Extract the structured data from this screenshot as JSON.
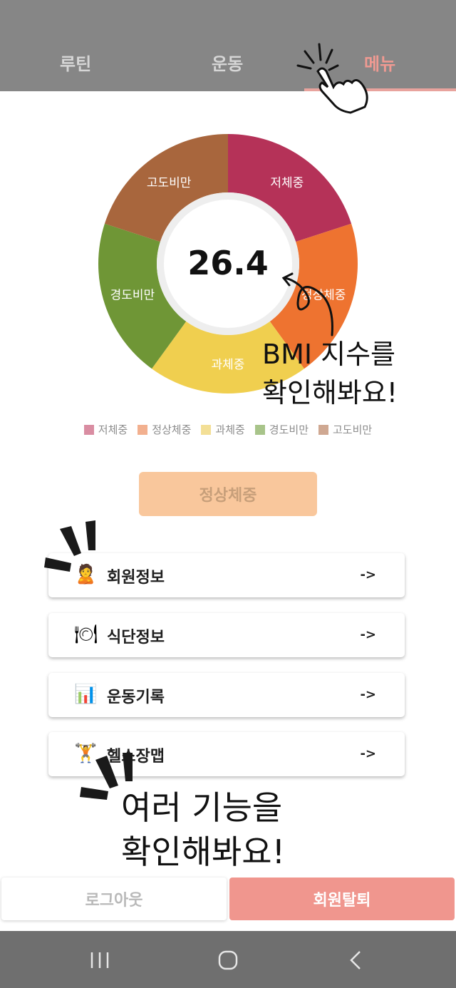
{
  "tabs": [
    {
      "label": "루틴",
      "active": false
    },
    {
      "label": "운동",
      "active": false
    },
    {
      "label": "메뉴",
      "active": true
    }
  ],
  "bmi": {
    "value": "26.4",
    "categories": [
      {
        "label": "저체중",
        "color": "#b53258"
      },
      {
        "label": "정상체중",
        "color": "#ee7330"
      },
      {
        "label": "과체중",
        "color": "#f0cf4f"
      },
      {
        "label": "경도비만",
        "color": "#6f9636"
      },
      {
        "label": "고도비만",
        "color": "#a8663d"
      }
    ],
    "status_label": "정상체중"
  },
  "legend": [
    {
      "label": "저체중",
      "color": "#d98da2"
    },
    {
      "label": "정상체중",
      "color": "#f2b08f"
    },
    {
      "label": "과체중",
      "color": "#f3df96"
    },
    {
      "label": "경도비만",
      "color": "#a8c48a"
    },
    {
      "label": "고도비만",
      "color": "#cfa892"
    }
  ],
  "menu": [
    {
      "icon": "person-icon",
      "glyph": "🙎",
      "label": "회원정보",
      "arrow": "->"
    },
    {
      "icon": "plate-icon",
      "glyph": "🍽",
      "label": "식단정보",
      "arrow": "->"
    },
    {
      "icon": "bar-chart-icon",
      "glyph": "📊",
      "label": "운동기록",
      "arrow": "->"
    },
    {
      "icon": "weightlifter-icon",
      "glyph": "🏋",
      "label": "헬스장맵",
      "arrow": "->"
    }
  ],
  "footer": {
    "logout_label": "로그아웃",
    "withdraw_label": "회원탈퇴"
  },
  "annotations": {
    "bmi_hint": "BMI 지수를\n확인해봐요!",
    "menu_hint": "여러 기능을\n확인해봐요!"
  }
}
